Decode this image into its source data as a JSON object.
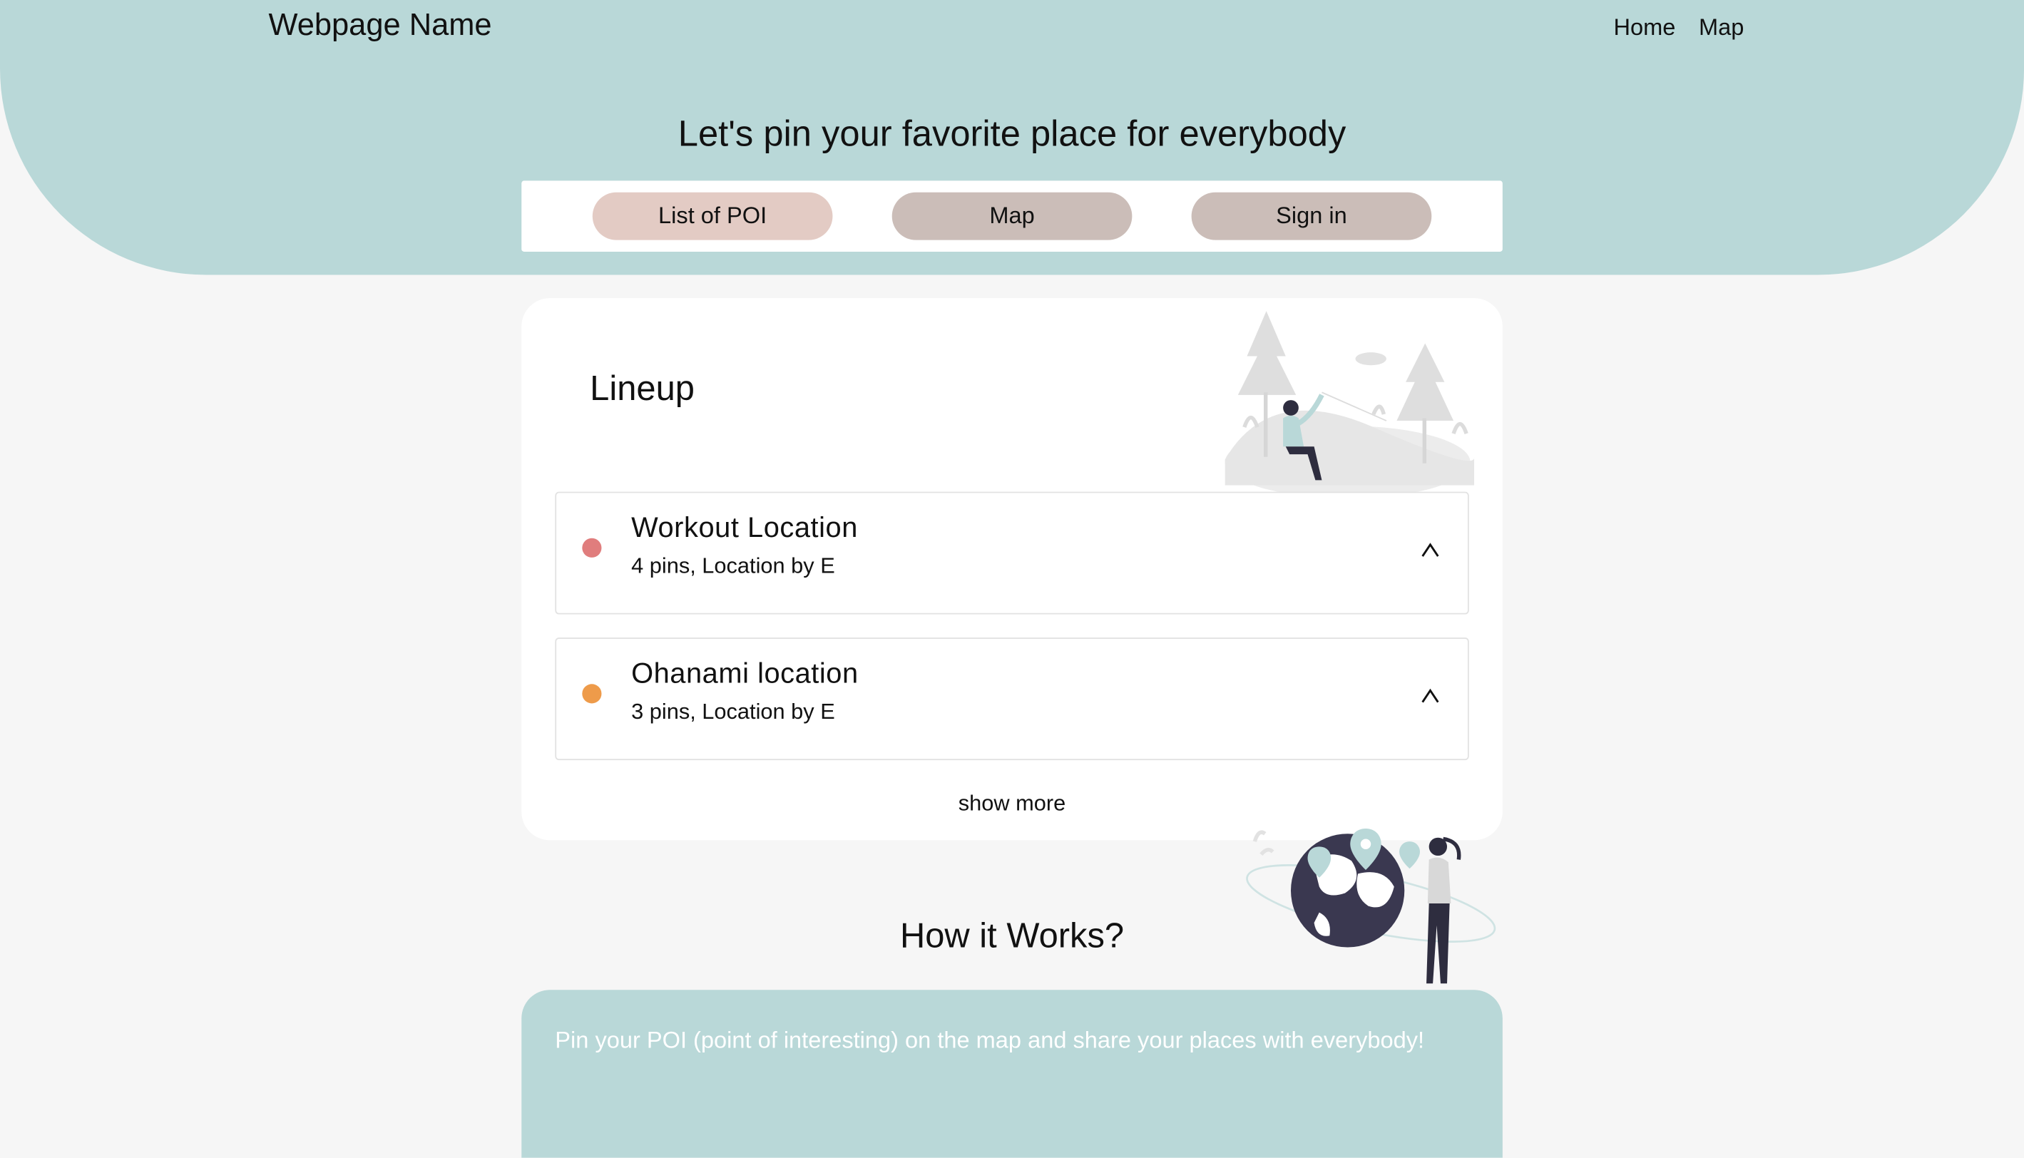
{
  "header": {
    "site_name": "Webpage Name",
    "nav": [
      "Home",
      "Map"
    ],
    "title": "Let's pin your favorite place for everybody"
  },
  "tabs": [
    {
      "label": "List of POI",
      "active": true
    },
    {
      "label": "Map",
      "active": false
    },
    {
      "label": "Sign in",
      "active": false
    }
  ],
  "lineup": {
    "heading": "Lineup",
    "items": [
      {
        "title": "Workout Location",
        "subtitle": "4 pins, Location by E",
        "dot_color": "#e07d7d",
        "icon": "chevron-up-icon"
      },
      {
        "title": "Ohanami location",
        "subtitle": "3 pins, Location by E",
        "dot_color": "#ee9b4a",
        "icon": "chevron-up-icon"
      }
    ],
    "show_more": "show more"
  },
  "how": {
    "heading": "How it Works?",
    "text": "Pin your POI (point of interesting) on the map and share your places with everybody!"
  },
  "colors": {
    "accent": "#b9d8d8",
    "tab_active": "#e3cbc4",
    "tab_inactive": "#cbbdb8",
    "background": "#f6f6f6"
  }
}
